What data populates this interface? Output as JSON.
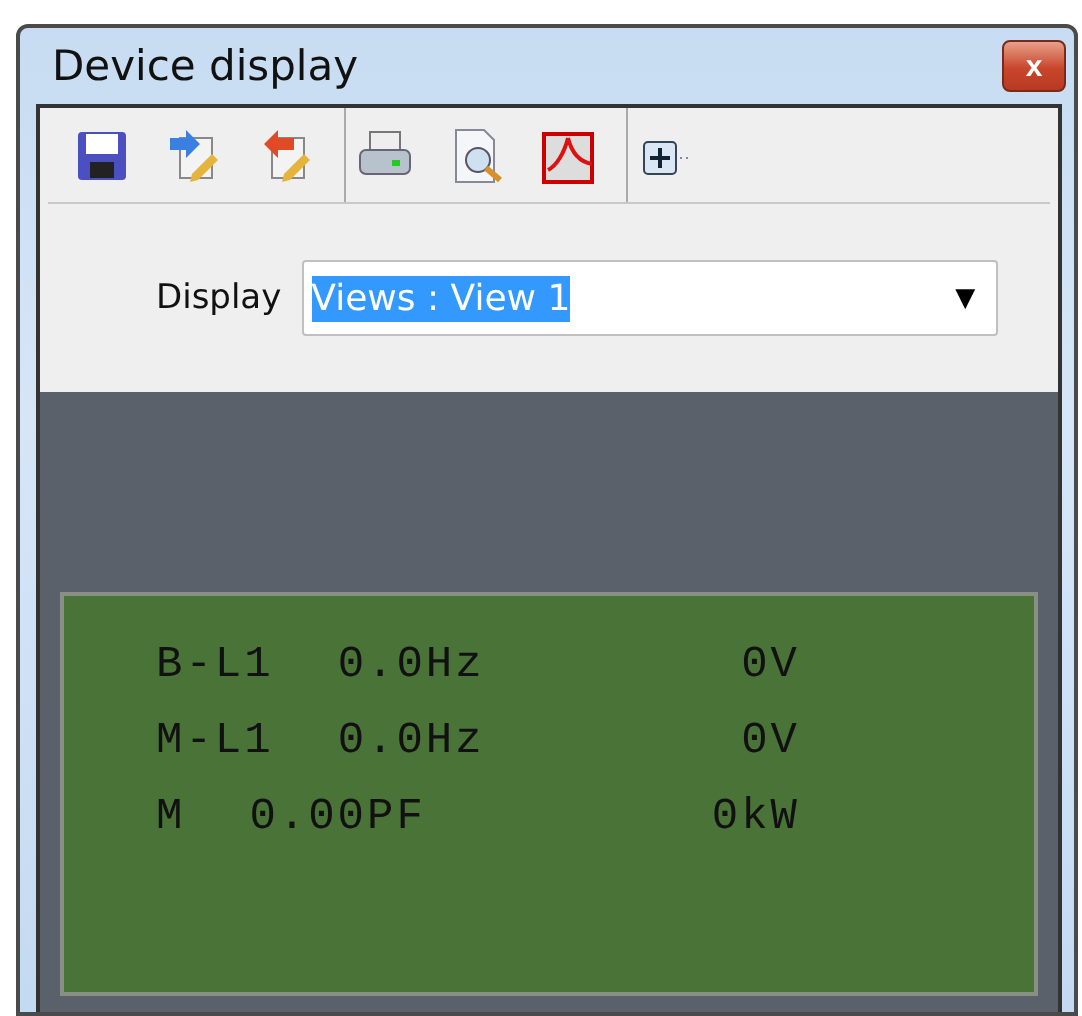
{
  "window": {
    "title": "Device display",
    "close_label": "x"
  },
  "toolbar": {
    "groups": [
      [
        {
          "kind": "save"
        },
        {
          "kind": "export"
        },
        {
          "kind": "import"
        }
      ],
      [
        {
          "kind": "print"
        },
        {
          "kind": "preview"
        },
        {
          "kind": "pdf"
        }
      ],
      [
        {
          "kind": "expand"
        }
      ]
    ]
  },
  "display": {
    "label": "Display",
    "value": "Views : View 1",
    "value_selected": true,
    "arrow": "▼"
  },
  "lcd": {
    "lines": [
      {
        "label": "B-L1",
        "value": "0.0Hz",
        "reading": "0V"
      },
      {
        "label": "M-L1",
        "value": "0.0Hz",
        "reading": "0V"
      },
      {
        "label": "M",
        "value": "0.00PF",
        "reading": "0kW"
      }
    ]
  }
}
